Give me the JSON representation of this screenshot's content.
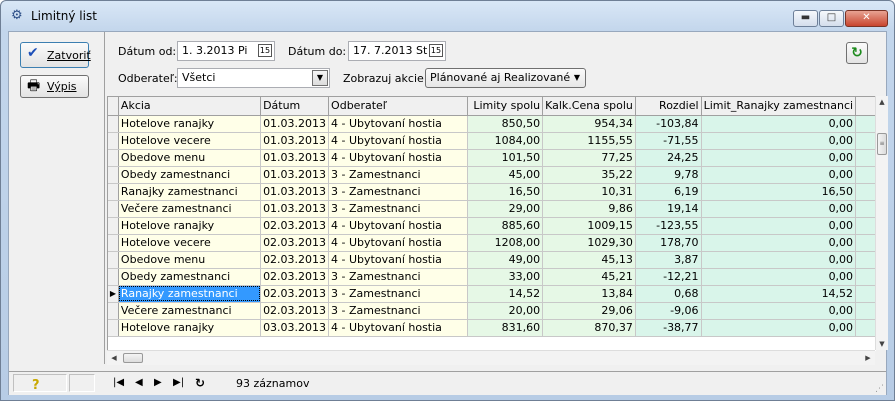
{
  "window": {
    "title": "Limitný list"
  },
  "buttons": {
    "close_label": "Zatvoriť",
    "print_label": "Výpis"
  },
  "filters": {
    "date_from_label": "Dátum od:",
    "date_from_value": "1. 3.2013   Pi",
    "date_to_label": "Dátum do:",
    "date_to_value": "17. 7.2013  St",
    "calendar_icon_text": "15",
    "customer_label": "Odberateľ:",
    "customer_value": "Všetci",
    "show_actions_label": "Zobrazuj akcie:",
    "show_actions_value": "Plánované aj Realizované"
  },
  "table": {
    "columns": [
      "Akcia",
      "Dátum",
      "Odberateľ",
      "Limity spolu",
      "Kalk.Cena spolu",
      "Rozdiel",
      "Limit_Ranajky zamestnanci"
    ],
    "rows": [
      [
        "Hotelove ranajky",
        "01.03.2013",
        "4 - Ubytovaní hostia",
        "850,50",
        "954,34",
        "-103,84",
        "0,00"
      ],
      [
        "Hotelove vecere",
        "01.03.2013",
        "4 - Ubytovaní hostia",
        "1084,00",
        "1155,55",
        "-71,55",
        "0,00"
      ],
      [
        "Obedove menu",
        "01.03.2013",
        "4 - Ubytovaní hostia",
        "101,50",
        "77,25",
        "24,25",
        "0,00"
      ],
      [
        "Obedy zamestnanci",
        "01.03.2013",
        "3 - Zamestnanci",
        "45,00",
        "35,22",
        "9,78",
        "0,00"
      ],
      [
        "Ranajky zamestnanci",
        "01.03.2013",
        "3 - Zamestnanci",
        "16,50",
        "10,31",
        "6,19",
        "16,50"
      ],
      [
        "Večere zamestnanci",
        "01.03.2013",
        "3 - Zamestnanci",
        "29,00",
        "9,86",
        "19,14",
        "0,00"
      ],
      [
        "Hotelove ranajky",
        "02.03.2013",
        "4 - Ubytovaní hostia",
        "885,60",
        "1009,15",
        "-123,55",
        "0,00"
      ],
      [
        "Hotelove vecere",
        "02.03.2013",
        "4 - Ubytovaní hostia",
        "1208,00",
        "1029,30",
        "178,70",
        "0,00"
      ],
      [
        "Obedove menu",
        "02.03.2013",
        "4 - Ubytovaní hostia",
        "49,00",
        "45,13",
        "3,87",
        "0,00"
      ],
      [
        "Obedy zamestnanci",
        "02.03.2013",
        "3 - Zamestnanci",
        "33,00",
        "45,21",
        "-12,21",
        "0,00"
      ],
      [
        "Ranajky zamestnanci",
        "02.03.2013",
        "3 - Zamestnanci",
        "14,52",
        "13,84",
        "0,68",
        "14,52"
      ],
      [
        "Večere zamestnanci",
        "02.03.2013",
        "3 - Zamestnanci",
        "20,00",
        "29,06",
        "-9,06",
        "0,00"
      ],
      [
        "Hotelove ranajky",
        "03.03.2013",
        "4 - Ubytovaní hostia",
        "831,60",
        "870,37",
        "-38,77",
        "0,00"
      ]
    ],
    "selected_row": 10
  },
  "status": {
    "record_count": "93 záznamov",
    "help_icon": "?"
  },
  "icons": {
    "app": "gear-icon",
    "check": "check-icon",
    "printer": "printer-icon",
    "refresh": "refresh-icon",
    "help": "help-icon",
    "first": "first-record-icon",
    "prev": "prev-record-icon",
    "next": "next-record-icon",
    "last": "last-record-icon",
    "reload": "reload-icon"
  },
  "colors": {
    "selection": "#3399ff",
    "text_cell": "#ffffe8",
    "num_cell": "#e6f8e6",
    "diff_cell": "#d9f5ea",
    "check": "#1d4fb8",
    "refresh": "#1d8a1d"
  }
}
